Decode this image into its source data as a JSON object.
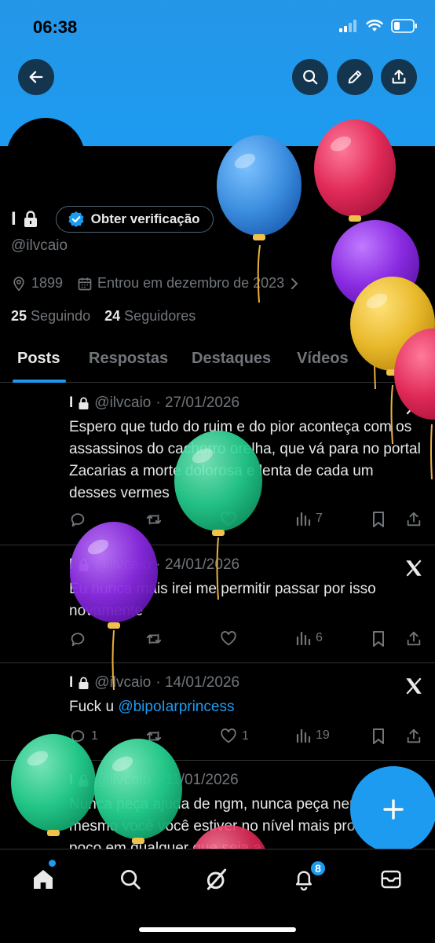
{
  "status_bar": {
    "time": "06:38"
  },
  "header": {
    "back_icon": "arrow-left-icon",
    "search_icon": "search-icon",
    "edit_icon": "pencil-icon",
    "share_icon": "share-icon"
  },
  "profile": {
    "name": "I",
    "verify_label": "Obter verificação",
    "handle": "@ilvcaio",
    "location": "1899",
    "joined": "Entrou em dezembro de 2023",
    "following_count": "25",
    "following_label": "Seguindo",
    "followers_count": "24",
    "followers_label": "Seguidores"
  },
  "tabs": [
    "Posts",
    "Respostas",
    "Destaques",
    "Vídeos",
    "Fot"
  ],
  "posts": [
    {
      "name": "I",
      "handle": "@ilvcaio",
      "date": "· 27/01/2026",
      "text": "Espero que tudo do ruim e do pior aconteça com os assassinos do cachorro orelha, que vá para no portal Zacarias a morte dolorosa e lenta de cada um desses vermes",
      "views": "7"
    },
    {
      "name": "I",
      "handle": "@ilvcaio",
      "date": "· 24/01/2026",
      "text": "Eu nunca mais irei me permitir passar por isso novamente",
      "views": "6"
    },
    {
      "name": "I",
      "handle": "@ilvcaio",
      "date": "· 14/01/2026",
      "text_prefix": "Fuck u ",
      "mention": "@bipoIarprincess",
      "replies": "1",
      "likes": "1",
      "views": "19"
    },
    {
      "name": "I",
      "handle": "@ilvcaio",
      "date": "· 11/01/2026",
      "text": "Nunca peça ajuda de ngm, nunca peça nem até mesmo você você estiver no nível mais profundo do poço em qualquer que seja a"
    }
  ],
  "notifications_badge": "8",
  "colors": {
    "accent": "#1d9bf0",
    "background": "#000000",
    "muted": "#71767b",
    "text": "#e7e9ea"
  }
}
